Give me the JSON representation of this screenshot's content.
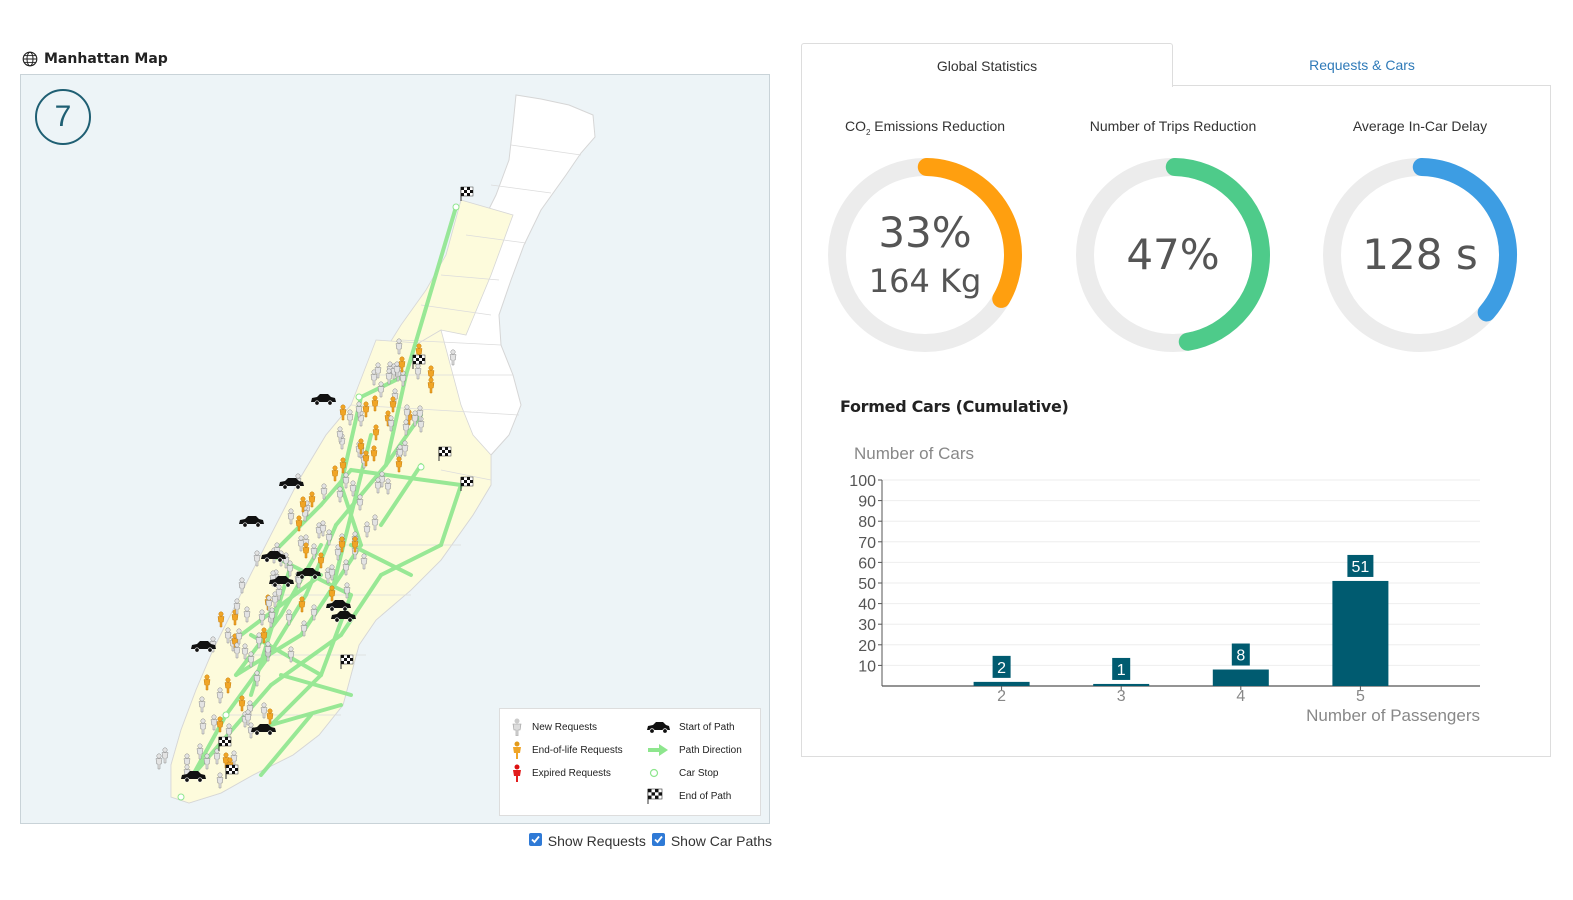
{
  "map": {
    "title": "Manhattan Map",
    "step": "7",
    "legend": [
      {
        "icon": "new-request-icon",
        "label": "New Requests"
      },
      {
        "icon": "end-of-life-request-icon",
        "label": "End-of-life Requests"
      },
      {
        "icon": "expired-request-icon",
        "label": "Expired Requests"
      },
      {
        "icon": "car-icon",
        "label": "Start of Path"
      },
      {
        "icon": "arrow-icon",
        "label": "Path Direction"
      },
      {
        "icon": "car-stop-icon",
        "label": "Car Stop"
      },
      {
        "icon": "checkered-flag-icon",
        "label": "End of Path"
      }
    ],
    "show_requests_label": "Show Requests",
    "show_requests_checked": true,
    "show_car_paths_label": "Show Car Paths",
    "show_car_paths_checked": true,
    "colors": {
      "water": "#edf4f7",
      "land": "#ffffff",
      "highlight": "#fdfbdc",
      "path": "#8ee68e"
    }
  },
  "tabs": [
    {
      "label": "Global Statistics",
      "active": true
    },
    {
      "label": "Requests & Cars",
      "active": false
    }
  ],
  "gauges": [
    {
      "label_prefix": "CO",
      "label_sub": "2",
      "label_suffix": " Emissions Reduction",
      "value": "33%",
      "secondary": "164 Kg",
      "fraction": 0.33,
      "color": "#ff9f0f"
    },
    {
      "label_prefix": "Number of Trips Reduction",
      "label_sub": "",
      "label_suffix": "",
      "value": "47%",
      "secondary": "",
      "fraction": 0.47,
      "color": "#4ecb8a"
    },
    {
      "label_prefix": "Average In-Car Delay",
      "label_sub": "",
      "label_suffix": "",
      "value": "128 s",
      "secondary": "",
      "fraction": 0.36,
      "color": "#3d9de3"
    }
  ],
  "chart_title": "Formed Cars (Cumulative)",
  "chart_data": {
    "type": "bar",
    "categories": [
      "2",
      "3",
      "4",
      "5"
    ],
    "values": [
      2,
      1,
      8,
      51
    ],
    "xlabel": "Number of Passengers",
    "ylabel": "Number of Cars",
    "ylim": [
      0,
      100
    ],
    "yticks": [
      "10",
      "20",
      "30",
      "40",
      "50",
      "60",
      "70",
      "80",
      "90",
      "100"
    ],
    "bar_color": "#005b70",
    "grid": true
  }
}
